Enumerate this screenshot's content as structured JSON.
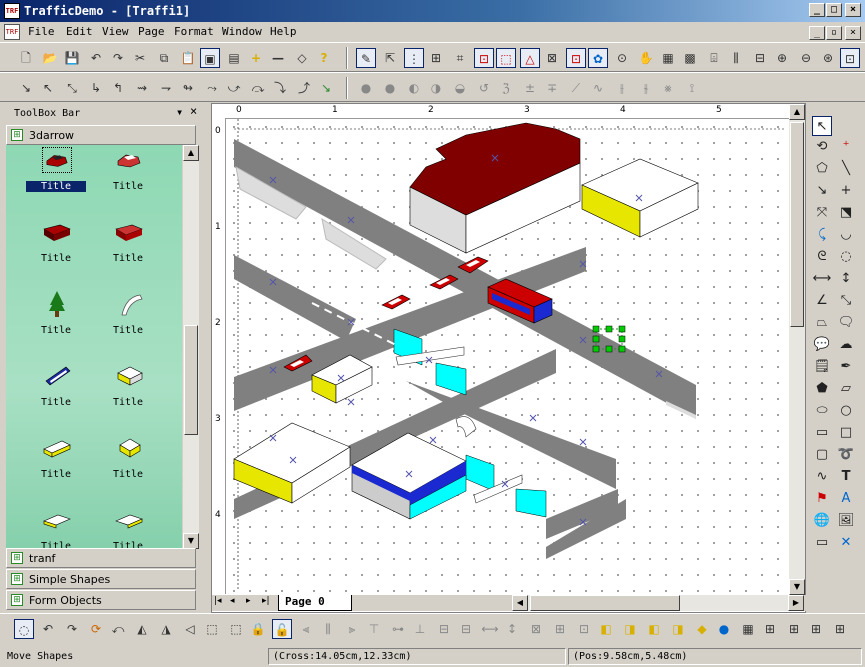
{
  "window": {
    "title": "TrafficDemo - [Traffi1]",
    "minimize": "_",
    "maximize": "□",
    "close": "×"
  },
  "menu": [
    "File",
    "Edit",
    "View",
    "Page",
    "Format",
    "Window",
    "Help"
  ],
  "toolbox": {
    "title": "ToolBox Bar",
    "categories_top": [
      "3darrow"
    ],
    "items": [
      "Title",
      "Title",
      "Title",
      "Title",
      "Title",
      "Title",
      "Title",
      "Title",
      "Title",
      "Title",
      "Title",
      "Title"
    ],
    "categories_bottom": [
      "tranf",
      "Simple Shapes",
      "Form Objects"
    ]
  },
  "ruler": {
    "h": [
      "0",
      "1",
      "2",
      "3",
      "4",
      "5"
    ],
    "v": [
      "0",
      "1",
      "2",
      "3",
      "4"
    ]
  },
  "page_tab": "Page  0",
  "status": {
    "left": "Move Shapes",
    "cross": "(Cross:14.05cm,12.33cm)",
    "pos": "(Pos:9.58cm,5.48cm)"
  },
  "colors": {
    "titlebar": "#0a246a",
    "toolbox_bg": "#8ed8b4",
    "road": "#808080",
    "roof": "#800000",
    "yellow": "#e6e600",
    "cyan": "#00ffff"
  },
  "icons": {
    "top_toolbar": [
      "new-icon",
      "open-icon",
      "save-icon",
      "undo-icon",
      "redo-icon",
      "cut-icon",
      "copy-icon",
      "paste-icon",
      "paste-special-icon",
      "add-icon",
      "remove-icon",
      "eraser-icon",
      "help-icon"
    ]
  }
}
